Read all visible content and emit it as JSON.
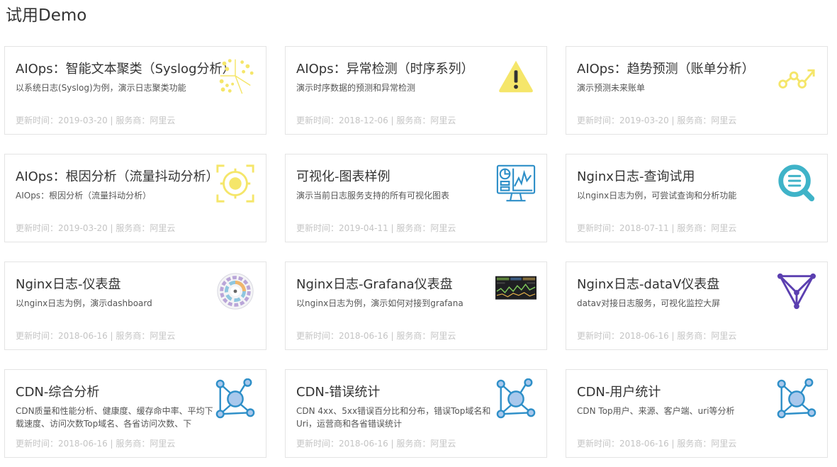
{
  "page": {
    "title": "试用Demo"
  },
  "colors": {
    "border": "#e4e4e4",
    "meta": "#c4c4c4",
    "yellow": "#f5e66a",
    "blue": "#2e8fc8",
    "teal": "#3fb3c8",
    "purple": "#5b3fb0",
    "network_fill": "#a9c8ec"
  },
  "cards": [
    {
      "title": "AIOps：智能文本聚类（Syslog分析）",
      "desc": "以系统日志(Syslog)为例，演示日志聚类功能",
      "meta": "更新时间：2019-03-20 | 服务商：阿里云",
      "icon": "cluster-dots-icon"
    },
    {
      "title": "AIOps：异常检测（时序系列）",
      "desc": "演示时序数据的预测和异常检测",
      "meta": "更新时间：2018-12-06 | 服务商：阿里云",
      "icon": "warning-icon"
    },
    {
      "title": "AIOps：趋势预测（账单分析）",
      "desc": "演示预测未来账单",
      "meta": "更新时间：2019-03-20 | 服务商：阿里云",
      "icon": "trend-icon"
    },
    {
      "title": "AIOps：根因分析（流量抖动分析）",
      "desc": "AIOps：根因分析（流量抖动分析）",
      "meta": "更新时间：2019-03-20 | 服务商：阿里云",
      "icon": "target-icon"
    },
    {
      "title": "可视化-图表样例",
      "desc": "演示当前日志服务支持的所有可视化图表",
      "meta": "更新时间：2019-04-11 | 服务商：阿里云",
      "icon": "monitor-chart-icon"
    },
    {
      "title": "Nginx日志-查询试用",
      "desc": "以nginx日志为例，可尝试查询和分析功能",
      "meta": "更新时间：2018-07-11 | 服务商：阿里云",
      "icon": "search-icon"
    },
    {
      "title": "Nginx日志-仪表盘",
      "desc": "以nginx日志为例，演示dashboard",
      "meta": "更新时间：2018-06-16 | 服务商：阿里云",
      "icon": "radial-chart-icon"
    },
    {
      "title": "Nginx日志-Grafana仪表盘",
      "desc": "以nginx日志为例，演示如何对接到grafana",
      "meta": "更新时间：2018-06-16 | 服务商：阿里云",
      "icon": "grafana-dashboard-icon"
    },
    {
      "title": "Nginx日志-dataV仪表盘",
      "desc": "datav对接日志服务，可视化监控大屏",
      "meta": "更新时间：2018-06-16 | 服务商：阿里云",
      "icon": "triangle-network-icon"
    },
    {
      "title": "CDN-综合分析",
      "desc": "CDN质量和性能分析、健康度、缓存命中率、平均下载速度、访问次数Top域名、各省访问次数、下",
      "meta": "更新时间：2018-06-16 | 服务商：阿里云",
      "icon": "network-icon"
    },
    {
      "title": "CDN-错误统计",
      "desc": "CDN 4xx、5xx错误百分比和分布，错误Top域名和Uri，运营商和各省错误统计",
      "meta": "更新时间：2018-06-16 | 服务商：阿里云",
      "icon": "network-icon"
    },
    {
      "title": "CDN-用户统计",
      "desc": "CDN Top用户、来源、客户端、uri等分析",
      "meta": "更新时间：2018-06-16 | 服务商：阿里云",
      "icon": "network-icon"
    }
  ]
}
